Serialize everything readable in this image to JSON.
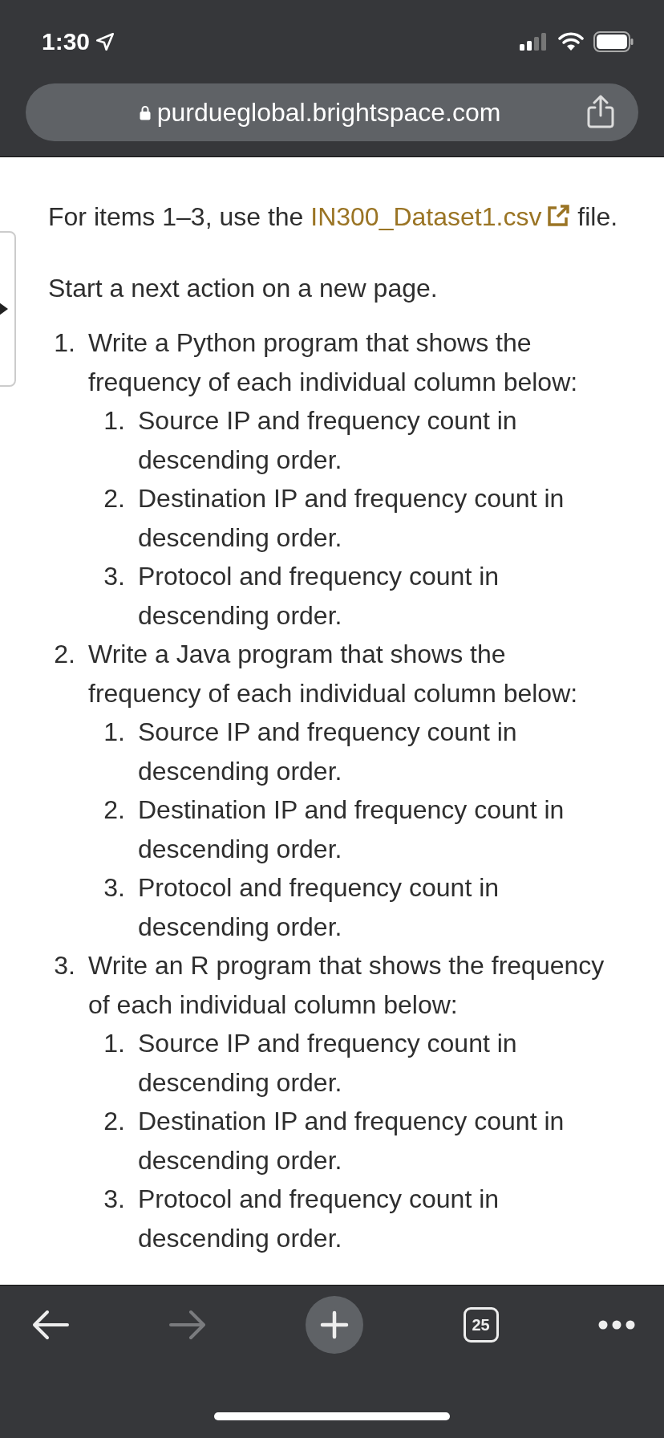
{
  "status_bar": {
    "time": "1:30"
  },
  "address_bar": {
    "url": "purdueglobal.brightspace.com"
  },
  "content": {
    "intro": {
      "before": "For items 1–3, use the ",
      "link": "IN300_Dataset1.csv",
      "after": "file."
    },
    "note": "Start a next action on a new page.",
    "items": [
      {
        "number": "1.",
        "text": "Write a Python program that shows the frequency of each individual column below:",
        "children": [
          {
            "number": "1.",
            "text": "Source IP and frequency count in descending order."
          },
          {
            "number": "2.",
            "text": "Destination IP and frequency count in descending order."
          },
          {
            "number": "3.",
            "text": "Protocol and frequency count in descending order."
          }
        ]
      },
      {
        "number": "2.",
        "text": "Write a Java program that shows the frequency of each individual column below:",
        "children": [
          {
            "number": "1.",
            "text": "Source IP and frequency count in descending order."
          },
          {
            "number": "2.",
            "text": "Destination IP and frequency count in descending order."
          },
          {
            "number": "3.",
            "text": "Protocol and frequency count in descending order."
          }
        ]
      },
      {
        "number": "3.",
        "text": "Write an R program that shows the frequency of each individual column below:",
        "children": [
          {
            "number": "1.",
            "text": "Source IP and frequency count in descending order."
          },
          {
            "number": "2.",
            "text": "Destination IP and frequency count in descending order."
          },
          {
            "number": "3.",
            "text": "Protocol and frequency count in descending order."
          }
        ]
      }
    ]
  },
  "toolbar": {
    "back_disabled": false,
    "forward_disabled": true,
    "tab_count": "25"
  }
}
